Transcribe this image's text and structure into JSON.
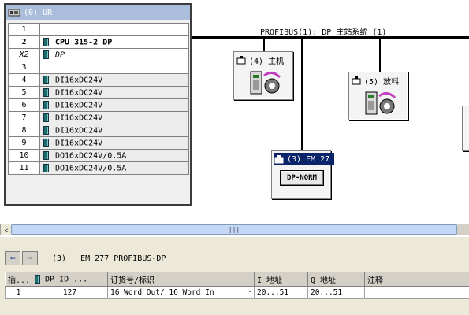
{
  "rack": {
    "title": "(0) UR",
    "rows": [
      {
        "slot": "1",
        "module": "",
        "style": "blank"
      },
      {
        "slot": "2",
        "module": "CPU 315-2 DP",
        "style": "bold"
      },
      {
        "slot": "X2",
        "module": "DP",
        "style": "ital"
      },
      {
        "slot": "3",
        "module": "",
        "style": "blank"
      },
      {
        "slot": "4",
        "module": "DI16xDC24V",
        "style": "normal"
      },
      {
        "slot": "5",
        "module": "DI16xDC24V",
        "style": "normal"
      },
      {
        "slot": "6",
        "module": "DI16xDC24V",
        "style": "normal"
      },
      {
        "slot": "7",
        "module": "DI16xDC24V",
        "style": "normal"
      },
      {
        "slot": "8",
        "module": "DI16xDC24V",
        "style": "normal"
      },
      {
        "slot": "9",
        "module": "DI16xDC24V",
        "style": "normal"
      },
      {
        "slot": "10",
        "module": "DO16xDC24V/0.5A",
        "style": "normal"
      },
      {
        "slot": "11",
        "module": "DO16xDC24V/0.5A",
        "style": "normal"
      }
    ]
  },
  "bus": {
    "label": "PROFIBUS(1): DP 主站系统 (1)"
  },
  "stations": {
    "main": {
      "title": "(4) 主机"
    },
    "feed": {
      "title": "(5) 放料"
    },
    "em277": {
      "title": "(3) EM 27",
      "badge": "DP-NORM"
    }
  },
  "scrollbar": {
    "left_arrow": "<",
    "grip": "|||"
  },
  "detail": {
    "slot_label": "(3)",
    "name": "EM 277 PROFIBUS-DP",
    "columns": [
      "插...",
      "DP ID ...",
      "订货号/标识",
      "I 地址",
      "Q 地址",
      "注释"
    ],
    "rows": [
      {
        "slot": "1",
        "dpid": "127",
        "order": "16 Word Out/ 16 Word In",
        "order_suffix": "-",
        "iaddr": "20...51",
        "qaddr": "20...51",
        "comment": ""
      }
    ]
  },
  "icons": {
    "rack": "rack-icon",
    "station": "station-icon",
    "module": "module-icon",
    "back": "back-arrow-icon",
    "forward": "forward-arrow-icon"
  }
}
